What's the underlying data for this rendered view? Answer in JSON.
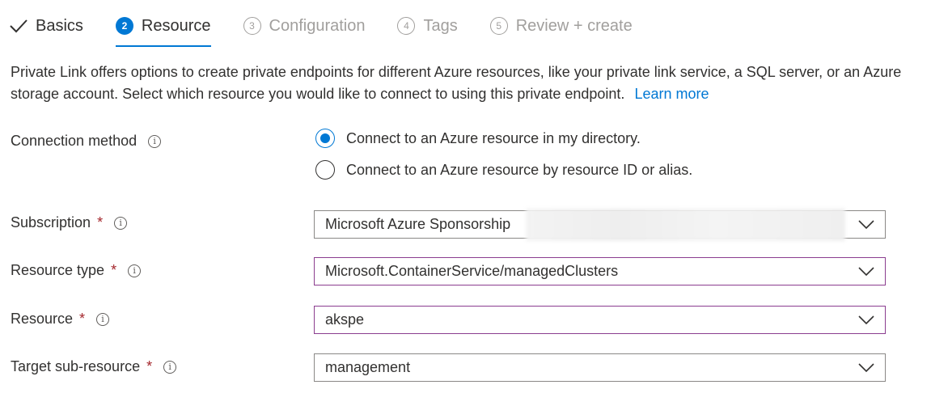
{
  "tabs": [
    {
      "label": "Basics",
      "state": "done"
    },
    {
      "num": "2",
      "label": "Resource",
      "state": "active"
    },
    {
      "num": "3",
      "label": "Configuration",
      "state": "pending"
    },
    {
      "num": "4",
      "label": "Tags",
      "state": "pending"
    },
    {
      "num": "5",
      "label": "Review + create",
      "state": "pending"
    }
  ],
  "description": {
    "text": "Private Link offers options to create private endpoints for different Azure resources, like your private link service, a SQL server, or an Azure storage account. Select which resource you would like to connect to using this private endpoint.",
    "link": "Learn more"
  },
  "connection": {
    "label": "Connection method",
    "options": [
      {
        "label": "Connect to an Azure resource in my directory.",
        "checked": true
      },
      {
        "label": "Connect to an Azure resource by resource ID or alias.",
        "checked": false
      }
    ]
  },
  "fields": {
    "subscription": {
      "label": "Subscription",
      "required": "*",
      "value": "Microsoft Azure Sponsorship"
    },
    "resource_type": {
      "label": "Resource type",
      "required": "*",
      "value": "Microsoft.ContainerService/managedClusters"
    },
    "resource": {
      "label": "Resource",
      "required": "*",
      "value": "akspe"
    },
    "target_sub_resource": {
      "label": "Target sub-resource",
      "required": "*",
      "value": "management"
    }
  },
  "info_glyph": "i",
  "colors": {
    "accent": "#0078d4",
    "required": "#a4262c",
    "focus_border": "#8b3d8f",
    "muted": "#a19f9d"
  }
}
